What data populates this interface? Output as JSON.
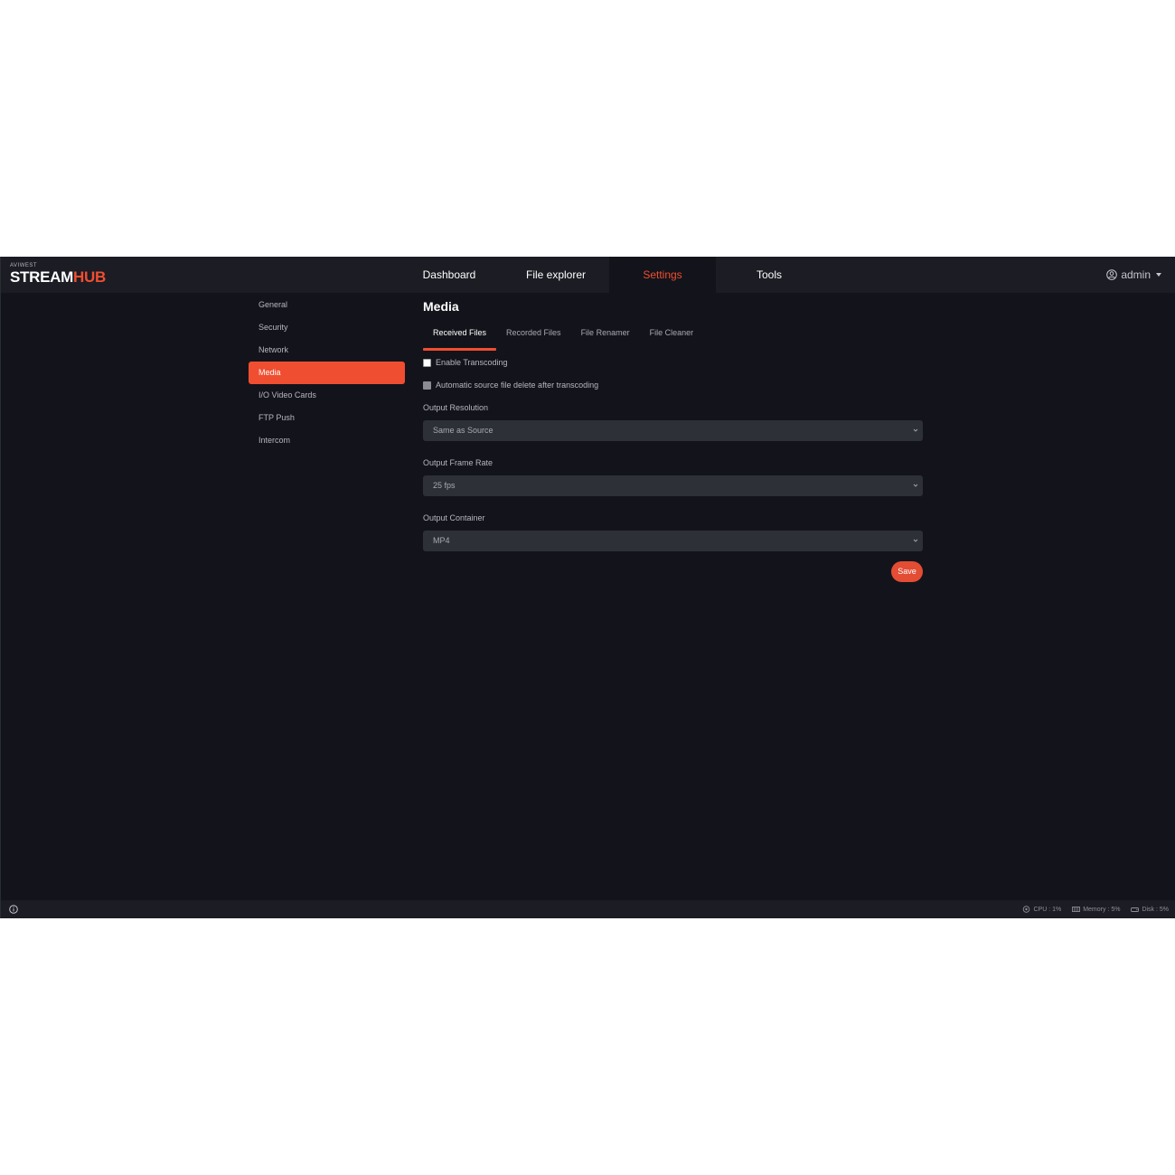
{
  "brand": {
    "small": "AVIWEST",
    "main_white": "STREAM",
    "main_orange": "HUB"
  },
  "nav": {
    "items": [
      {
        "label": "Dashboard"
      },
      {
        "label": "File explorer"
      },
      {
        "label": "Settings"
      },
      {
        "label": "Tools"
      }
    ],
    "active": "Settings"
  },
  "user": {
    "name": "admin",
    "icon": "user-circle-icon"
  },
  "sidebar": {
    "items": [
      {
        "label": "General"
      },
      {
        "label": "Security"
      },
      {
        "label": "Network"
      },
      {
        "label": "Media"
      },
      {
        "label": "I/O Video Cards"
      },
      {
        "label": "FTP Push"
      },
      {
        "label": "Intercom"
      }
    ],
    "active": "Media"
  },
  "main": {
    "title": "Media",
    "tabs": [
      {
        "label": "Received Files"
      },
      {
        "label": "Recorded Files"
      },
      {
        "label": "File Renamer"
      },
      {
        "label": "File Cleaner"
      }
    ],
    "active_tab": "Received Files",
    "enable_transcoding": {
      "label": "Enable Transcoding",
      "checked": false
    },
    "auto_delete": {
      "label": "Automatic source file delete after transcoding",
      "checked": false,
      "disabled": true
    },
    "output_resolution": {
      "label": "Output Resolution",
      "value": "Same as Source"
    },
    "output_frame_rate": {
      "label": "Output Frame Rate",
      "value": "25 fps"
    },
    "output_container": {
      "label": "Output Container",
      "value": "MP4"
    },
    "save_label": "Save"
  },
  "footer": {
    "info_icon": "info-circle-icon",
    "cpu": "CPU : 1%",
    "memory": "Memory : 5%",
    "disk": "Disk : 5%"
  },
  "colors": {
    "accent": "#f04e30",
    "background": "#13141b",
    "bar": "#1b1c24",
    "input": "#2e3038"
  }
}
